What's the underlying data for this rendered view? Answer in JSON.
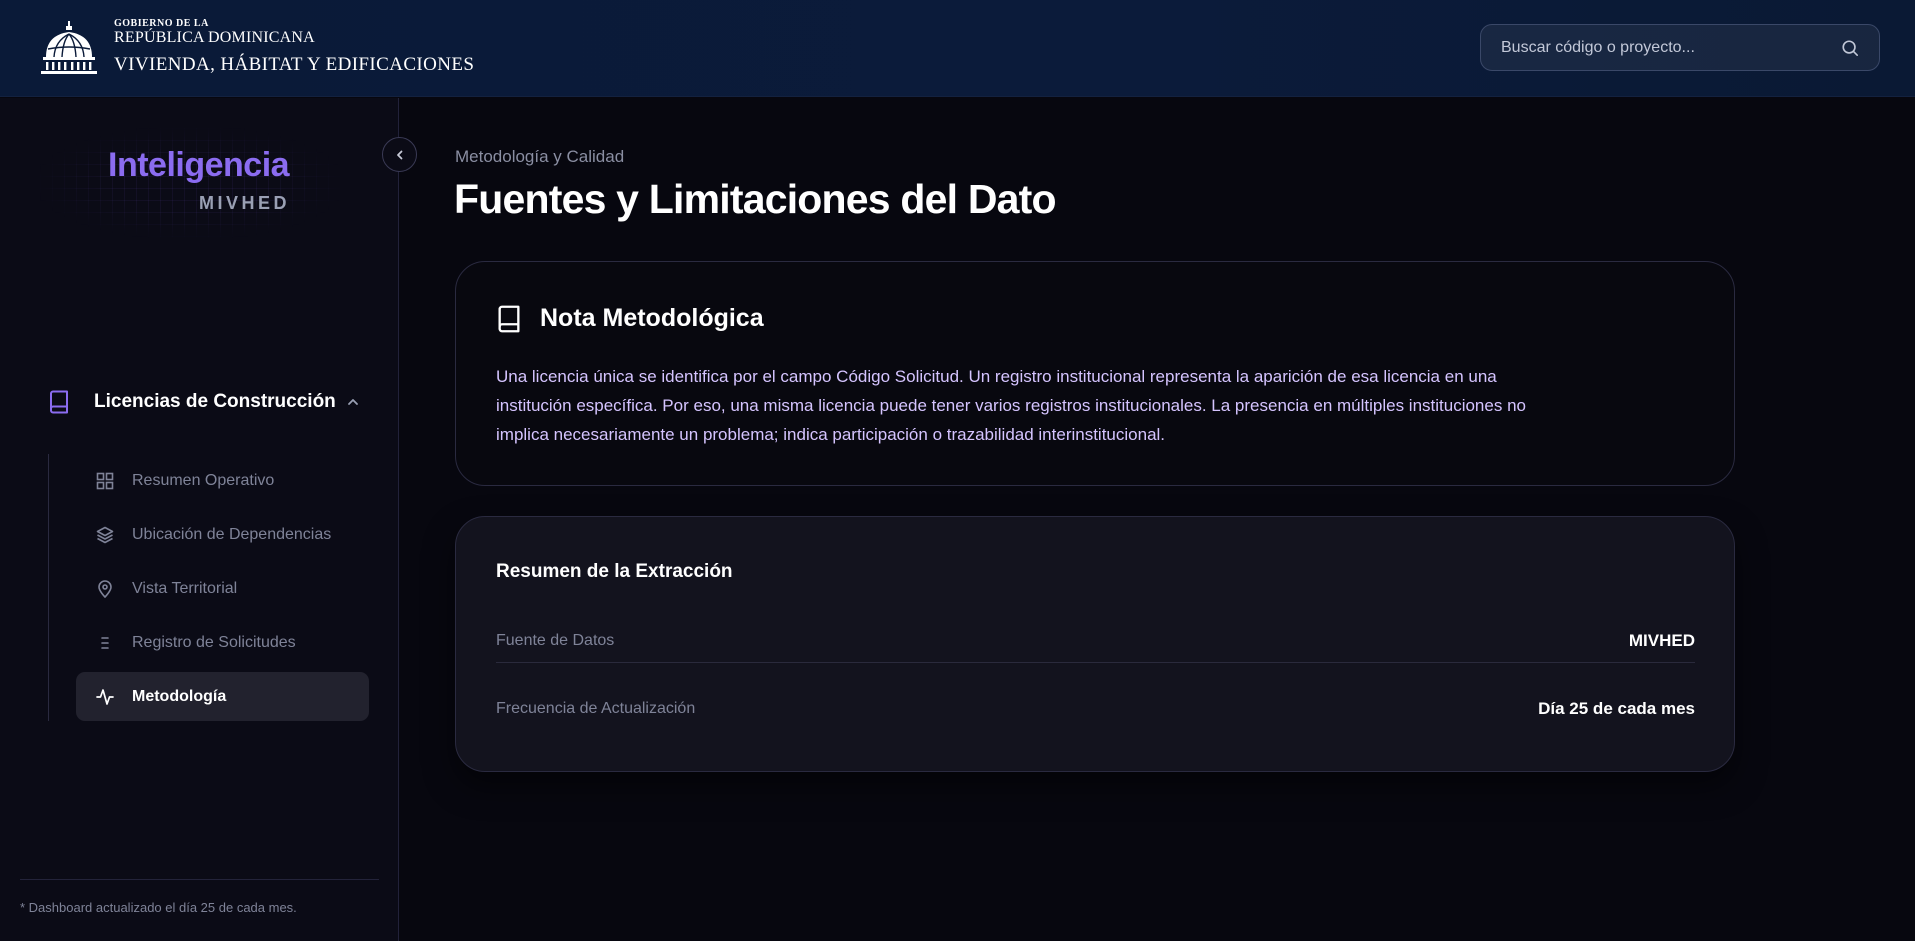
{
  "header": {
    "logo": {
      "line1": "GOBIERNO DE LA",
      "line2": "REPÚBLICA DOMINICANA",
      "line3": "VIVIENDA, HÁBITAT Y EDIFICACIONES"
    },
    "search": {
      "placeholder": "Buscar código o proyecto...",
      "value": ""
    }
  },
  "sidebar": {
    "brand_title": "Inteligencia",
    "brand_subtitle": "MIVHED",
    "section": {
      "label": "Licencias de Construcción",
      "expanded": true
    },
    "items": [
      {
        "label": "Resumen Operativo",
        "icon": "grid-icon",
        "active": false
      },
      {
        "label": "Ubicación de Dependencias",
        "icon": "layers-icon",
        "active": false
      },
      {
        "label": "Vista Territorial",
        "icon": "map-pin-icon",
        "active": false
      },
      {
        "label": "Registro de Solicitudes",
        "icon": "list-icon",
        "active": false
      },
      {
        "label": "Metodología",
        "icon": "activity-icon",
        "active": true
      }
    ],
    "footer": "* Dashboard actualizado el día 25 de cada mes."
  },
  "main": {
    "breadcrumb": "Metodología y Calidad",
    "title": "Fuentes y Limitaciones del Dato",
    "note": {
      "title": "Nota Metodológica",
      "body": "Una licencia única se identifica por el campo Código Solicitud. Un registro institucional representa la aparición de esa licencia en una institución específica. Por eso, una misma licencia puede tener varios registros institucionales. La presencia en múltiples instituciones no implica necesariamente un problema; indica participación o trazabilidad interinstitucional."
    },
    "summary": {
      "title": "Resumen de la Extracción",
      "rows": [
        {
          "key": "Fuente de Datos",
          "value": "MIVHED"
        },
        {
          "key": "Frecuencia de Actualización",
          "value": "Día 25 de cada mes"
        }
      ]
    }
  },
  "colors": {
    "header_bg": "#0a1a38",
    "page_bg": "#07070f",
    "accent": "#8b6cf0",
    "note_text": "#d5c4ff"
  }
}
